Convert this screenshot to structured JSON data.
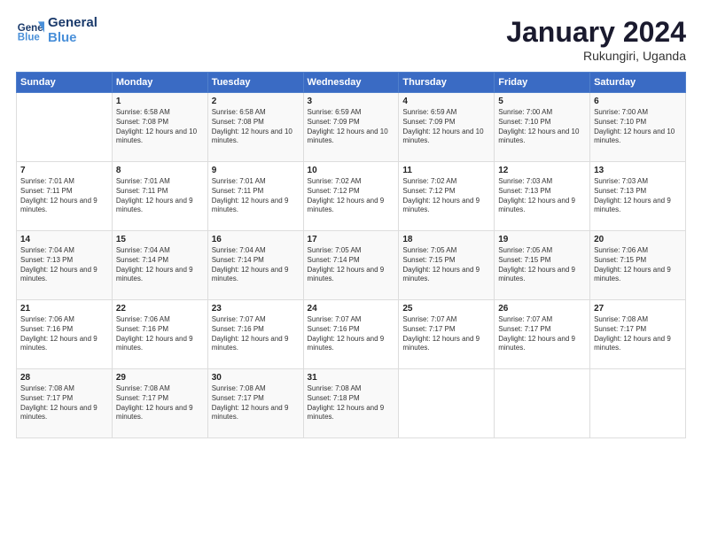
{
  "header": {
    "logo_line1": "General",
    "logo_line2": "Blue",
    "month": "January 2024",
    "location": "Rukungiri, Uganda"
  },
  "days_of_week": [
    "Sunday",
    "Monday",
    "Tuesday",
    "Wednesday",
    "Thursday",
    "Friday",
    "Saturday"
  ],
  "weeks": [
    [
      {
        "day": "",
        "sunrise": "",
        "sunset": "",
        "daylight": ""
      },
      {
        "day": "1",
        "sunrise": "Sunrise: 6:58 AM",
        "sunset": "Sunset: 7:08 PM",
        "daylight": "Daylight: 12 hours and 10 minutes."
      },
      {
        "day": "2",
        "sunrise": "Sunrise: 6:58 AM",
        "sunset": "Sunset: 7:08 PM",
        "daylight": "Daylight: 12 hours and 10 minutes."
      },
      {
        "day": "3",
        "sunrise": "Sunrise: 6:59 AM",
        "sunset": "Sunset: 7:09 PM",
        "daylight": "Daylight: 12 hours and 10 minutes."
      },
      {
        "day": "4",
        "sunrise": "Sunrise: 6:59 AM",
        "sunset": "Sunset: 7:09 PM",
        "daylight": "Daylight: 12 hours and 10 minutes."
      },
      {
        "day": "5",
        "sunrise": "Sunrise: 7:00 AM",
        "sunset": "Sunset: 7:10 PM",
        "daylight": "Daylight: 12 hours and 10 minutes."
      },
      {
        "day": "6",
        "sunrise": "Sunrise: 7:00 AM",
        "sunset": "Sunset: 7:10 PM",
        "daylight": "Daylight: 12 hours and 10 minutes."
      }
    ],
    [
      {
        "day": "7",
        "sunrise": "Sunrise: 7:01 AM",
        "sunset": "Sunset: 7:11 PM",
        "daylight": "Daylight: 12 hours and 9 minutes."
      },
      {
        "day": "8",
        "sunrise": "Sunrise: 7:01 AM",
        "sunset": "Sunset: 7:11 PM",
        "daylight": "Daylight: 12 hours and 9 minutes."
      },
      {
        "day": "9",
        "sunrise": "Sunrise: 7:01 AM",
        "sunset": "Sunset: 7:11 PM",
        "daylight": "Daylight: 12 hours and 9 minutes."
      },
      {
        "day": "10",
        "sunrise": "Sunrise: 7:02 AM",
        "sunset": "Sunset: 7:12 PM",
        "daylight": "Daylight: 12 hours and 9 minutes."
      },
      {
        "day": "11",
        "sunrise": "Sunrise: 7:02 AM",
        "sunset": "Sunset: 7:12 PM",
        "daylight": "Daylight: 12 hours and 9 minutes."
      },
      {
        "day": "12",
        "sunrise": "Sunrise: 7:03 AM",
        "sunset": "Sunset: 7:13 PM",
        "daylight": "Daylight: 12 hours and 9 minutes."
      },
      {
        "day": "13",
        "sunrise": "Sunrise: 7:03 AM",
        "sunset": "Sunset: 7:13 PM",
        "daylight": "Daylight: 12 hours and 9 minutes."
      }
    ],
    [
      {
        "day": "14",
        "sunrise": "Sunrise: 7:04 AM",
        "sunset": "Sunset: 7:13 PM",
        "daylight": "Daylight: 12 hours and 9 minutes."
      },
      {
        "day": "15",
        "sunrise": "Sunrise: 7:04 AM",
        "sunset": "Sunset: 7:14 PM",
        "daylight": "Daylight: 12 hours and 9 minutes."
      },
      {
        "day": "16",
        "sunrise": "Sunrise: 7:04 AM",
        "sunset": "Sunset: 7:14 PM",
        "daylight": "Daylight: 12 hours and 9 minutes."
      },
      {
        "day": "17",
        "sunrise": "Sunrise: 7:05 AM",
        "sunset": "Sunset: 7:14 PM",
        "daylight": "Daylight: 12 hours and 9 minutes."
      },
      {
        "day": "18",
        "sunrise": "Sunrise: 7:05 AM",
        "sunset": "Sunset: 7:15 PM",
        "daylight": "Daylight: 12 hours and 9 minutes."
      },
      {
        "day": "19",
        "sunrise": "Sunrise: 7:05 AM",
        "sunset": "Sunset: 7:15 PM",
        "daylight": "Daylight: 12 hours and 9 minutes."
      },
      {
        "day": "20",
        "sunrise": "Sunrise: 7:06 AM",
        "sunset": "Sunset: 7:15 PM",
        "daylight": "Daylight: 12 hours and 9 minutes."
      }
    ],
    [
      {
        "day": "21",
        "sunrise": "Sunrise: 7:06 AM",
        "sunset": "Sunset: 7:16 PM",
        "daylight": "Daylight: 12 hours and 9 minutes."
      },
      {
        "day": "22",
        "sunrise": "Sunrise: 7:06 AM",
        "sunset": "Sunset: 7:16 PM",
        "daylight": "Daylight: 12 hours and 9 minutes."
      },
      {
        "day": "23",
        "sunrise": "Sunrise: 7:07 AM",
        "sunset": "Sunset: 7:16 PM",
        "daylight": "Daylight: 12 hours and 9 minutes."
      },
      {
        "day": "24",
        "sunrise": "Sunrise: 7:07 AM",
        "sunset": "Sunset: 7:16 PM",
        "daylight": "Daylight: 12 hours and 9 minutes."
      },
      {
        "day": "25",
        "sunrise": "Sunrise: 7:07 AM",
        "sunset": "Sunset: 7:17 PM",
        "daylight": "Daylight: 12 hours and 9 minutes."
      },
      {
        "day": "26",
        "sunrise": "Sunrise: 7:07 AM",
        "sunset": "Sunset: 7:17 PM",
        "daylight": "Daylight: 12 hours and 9 minutes."
      },
      {
        "day": "27",
        "sunrise": "Sunrise: 7:08 AM",
        "sunset": "Sunset: 7:17 PM",
        "daylight": "Daylight: 12 hours and 9 minutes."
      }
    ],
    [
      {
        "day": "28",
        "sunrise": "Sunrise: 7:08 AM",
        "sunset": "Sunset: 7:17 PM",
        "daylight": "Daylight: 12 hours and 9 minutes."
      },
      {
        "day": "29",
        "sunrise": "Sunrise: 7:08 AM",
        "sunset": "Sunset: 7:17 PM",
        "daylight": "Daylight: 12 hours and 9 minutes."
      },
      {
        "day": "30",
        "sunrise": "Sunrise: 7:08 AM",
        "sunset": "Sunset: 7:17 PM",
        "daylight": "Daylight: 12 hours and 9 minutes."
      },
      {
        "day": "31",
        "sunrise": "Sunrise: 7:08 AM",
        "sunset": "Sunset: 7:18 PM",
        "daylight": "Daylight: 12 hours and 9 minutes."
      },
      {
        "day": "",
        "sunrise": "",
        "sunset": "",
        "daylight": ""
      },
      {
        "day": "",
        "sunrise": "",
        "sunset": "",
        "daylight": ""
      },
      {
        "day": "",
        "sunrise": "",
        "sunset": "",
        "daylight": ""
      }
    ]
  ]
}
